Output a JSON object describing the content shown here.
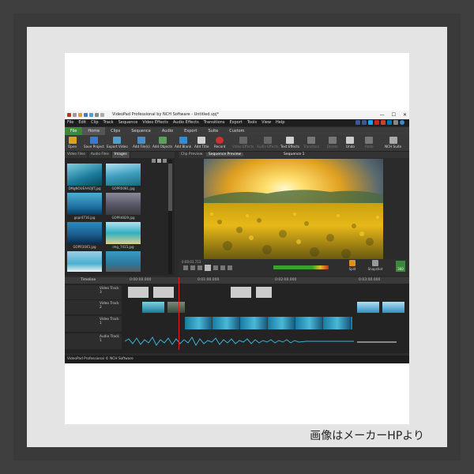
{
  "caption": "画像はメーカーHPより",
  "window": {
    "title": "VideoPad Professional by NCH Software - Untitled.vpj*",
    "controls": [
      "—",
      "☐",
      "✕"
    ]
  },
  "menu": [
    "File",
    "Edit",
    "Clip",
    "Track",
    "Sequence",
    "Video Effects",
    "Audio Effects",
    "Transitions",
    "Export",
    "Tools",
    "View",
    "Help"
  ],
  "ribbon_tabs": [
    "File",
    "Home",
    "Clips",
    "Sequence",
    "Audio",
    "Export",
    "Suite",
    "Custom"
  ],
  "toolbar": [
    {
      "label": "Open",
      "color": "#e0a020"
    },
    {
      "label": "Save Project",
      "color": "#3a7ad0"
    },
    {
      "label": "Export Video",
      "color": "#4aa0d0"
    },
    {
      "label": "Add File(s)",
      "color": "#4a8ad0"
    },
    {
      "label": "Add Objects",
      "color": "#5aa05a"
    },
    {
      "label": "Add Blank",
      "color": "#3a8ad0"
    },
    {
      "label": "Add Title",
      "color": "#d0d0d0"
    },
    {
      "label": "Record",
      "color": "#d03030"
    },
    {
      "label": "Video Effects",
      "color": "#666666"
    },
    {
      "label": "Audio Effects",
      "color": "#666666"
    },
    {
      "label": "Text Effects",
      "color": "#d0d0d0"
    },
    {
      "label": "Transition",
      "color": "#777777"
    },
    {
      "label": "Delete",
      "color": "#777777"
    },
    {
      "label": "Undo",
      "color": "#cccccc"
    },
    {
      "label": "Redo",
      "color": "#777777"
    },
    {
      "label": "NCH Suite",
      "color": "#aaaaaa"
    }
  ],
  "bin": {
    "tabs": [
      "Video Files",
      "Audio Files",
      "Images"
    ],
    "items": [
      {
        "name": "DMgNOUEAAOJIT.jpg"
      },
      {
        "name": "GOPR0081.jpg"
      },
      {
        "name": "gopr4716.jpg"
      },
      {
        "name": "GOPR4829.jpg"
      },
      {
        "name": "GOPR3045.jpg"
      },
      {
        "name": "img_7415.jpg"
      },
      {
        "name": ""
      },
      {
        "name": ""
      }
    ]
  },
  "preview": {
    "tabs": [
      "Clip Preview",
      "Sequence Preview"
    ],
    "sequence": "Sequence 1",
    "timecode": "0:00:01.713",
    "split": "Split",
    "snapshot": "Snapshot",
    "res": "360"
  },
  "timeline": {
    "label": "Timeline",
    "ticks": [
      "0:00:00.000",
      "0:01:00.000",
      "0:02:00.000",
      "0:03:00.000"
    ],
    "tracks": [
      "Video Track 3",
      "Video Track 2",
      "Video Track 1",
      "Audio Track 1"
    ]
  },
  "status": "VideoPad Professional © NCH Software"
}
